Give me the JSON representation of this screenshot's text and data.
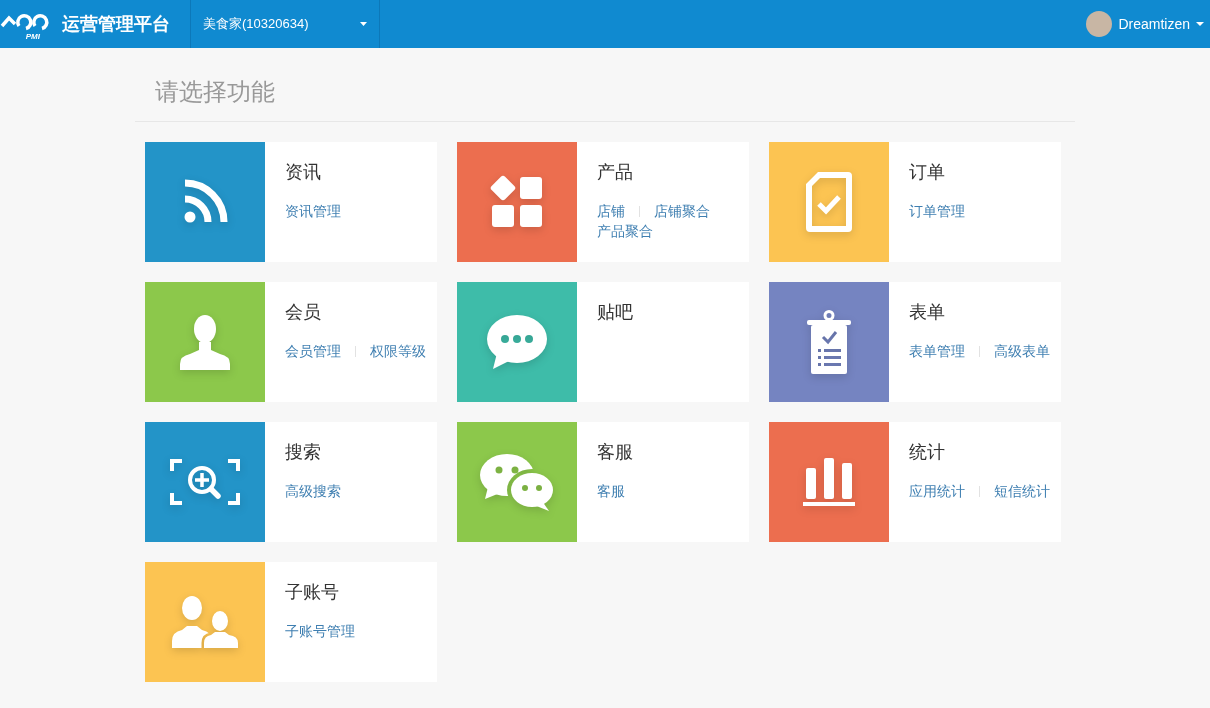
{
  "header": {
    "logo_text": "PMI",
    "title": "运营管理平台",
    "store_selector": "美食家(10320634)",
    "user_name": "Dreamtizen"
  },
  "page_title": "请选择功能",
  "modules": [
    {
      "title": "资讯",
      "color": "#2394c8",
      "links": [
        "资讯管理"
      ]
    },
    {
      "title": "产品",
      "color": "#ec6e4f",
      "links": [
        "店铺",
        "店铺聚合",
        "产品聚合"
      ]
    },
    {
      "title": "订单",
      "color": "#fcc452",
      "links": [
        "订单管理"
      ]
    },
    {
      "title": "会员",
      "color": "#8cc84b",
      "links": [
        "会员管理",
        "权限等级"
      ]
    },
    {
      "title": "贴吧",
      "color": "#3ebca9"
    },
    {
      "title": "表单",
      "color": "#7584c1",
      "links": [
        "表单管理",
        "高级表单"
      ]
    },
    {
      "title": "搜索",
      "color": "#2394c8",
      "links": [
        "高级搜索"
      ]
    },
    {
      "title": "客服",
      "color": "#8cc84b",
      "links": [
        "客服"
      ]
    },
    {
      "title": "统计",
      "color": "#ec6e4f",
      "links": [
        "应用统计",
        "短信统计"
      ]
    },
    {
      "title": "子账号",
      "color": "#fcc452",
      "links": [
        "子账号管理"
      ]
    }
  ]
}
